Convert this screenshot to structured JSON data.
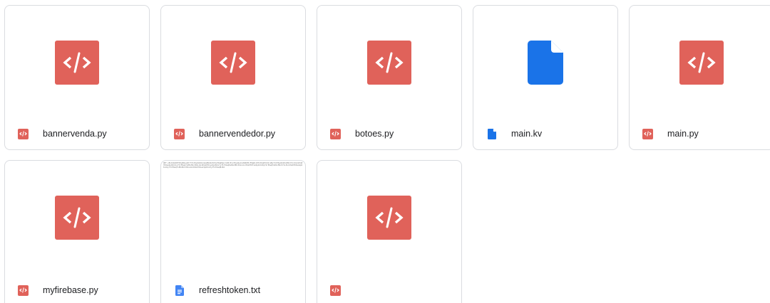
{
  "files": [
    {
      "name": "bannervenda.py",
      "type": "code",
      "type_icon": "code-file-icon"
    },
    {
      "name": "bannervendedor.py",
      "type": "code",
      "type_icon": "code-file-icon"
    },
    {
      "name": "botoes.py",
      "type": "code",
      "type_icon": "code-file-icon"
    },
    {
      "name": "main.kv",
      "type": "generic",
      "type_icon": "generic-file-icon"
    },
    {
      "name": "main.py",
      "type": "code",
      "type_icon": "code-file-icon"
    },
    {
      "name": "myfirebase.py",
      "type": "code",
      "type_icon": "code-file-icon"
    },
    {
      "name": "refreshtoken.txt",
      "type": "text",
      "type_icon": "text-document-icon",
      "preview": "AMf-vBxS3kQ9HfP2yN8LwZ0rT7dJ5qU1mV6cG4eB9nK2hX3sY8aW0pL7oR5iE1uT6yQ4wC2vN9bM3jF8gD1zH7kS5aP0lO2iU8yT4rE6wQ3vB1nM9cX7zL5kJ2hG8fD0sA4pO6iU1yT3rE9wQ7vB5nM2cX8zL4kJ0hG6fD1sA3pO9iU7yT5rE2wQ8vB4nM0cX6zL1kJ3hG9fD7sA5pO2iU8yT4rE6wQ3vB1nM9cX7zL5kJ2hG8fD0sA4pO6iU1yT3rE9wQ7vB5nM2cX8zL4kJ0hG6fD1sA3pO9iU7yT5rE2wQ8vB4"
    }
  ],
  "colors": {
    "code": "#e0625a",
    "generic": "#1a73e8",
    "text": "#4285f4"
  }
}
